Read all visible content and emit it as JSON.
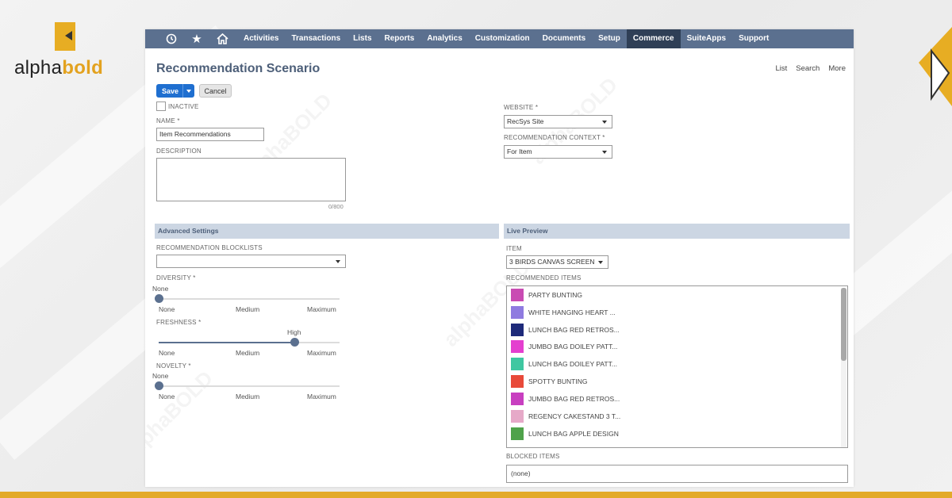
{
  "brand": {
    "logo_text_light": "alpha",
    "logo_text_bold": "bold",
    "watermark": "alphaBOLD",
    "accent_color": "#e3aa2a"
  },
  "nav": {
    "icons": [
      "recent-icon",
      "star-icon",
      "home-icon"
    ],
    "items": [
      "Activities",
      "Transactions",
      "Lists",
      "Reports",
      "Analytics",
      "Customization",
      "Documents",
      "Setup",
      "Commerce",
      "SuiteApps",
      "Support"
    ],
    "active": "Commerce"
  },
  "page": {
    "title": "Recommendation Scenario",
    "links": [
      "List",
      "Search",
      "More"
    ]
  },
  "actions": {
    "save_label": "Save",
    "cancel_label": "Cancel"
  },
  "form": {
    "inactive_label": "INACTIVE",
    "name_label": "NAME *",
    "name_value": "Item Recommendations",
    "description_label": "DESCRIPTION",
    "description_counter": "0/800",
    "website_label": "WEBSITE *",
    "website_value": "RecSys Site",
    "context_label": "RECOMMENDATION CONTEXT *",
    "context_value": "For Item"
  },
  "advanced": {
    "header": "Advanced Settings",
    "blocklists_label": "RECOMMENDATION BLOCKLISTS",
    "blocklists_value": "",
    "sliders": [
      {
        "label": "DIVERSITY *",
        "current": "None",
        "level": 0
      },
      {
        "label": "FRESHNESS *",
        "current": "High",
        "level": 0.75
      },
      {
        "label": "NOVELTY *",
        "current": "None",
        "level": 0
      }
    ],
    "scale": [
      "None",
      "Medium",
      "Maximum"
    ]
  },
  "preview": {
    "header": "Live Preview",
    "item_label": "ITEM",
    "item_value": "3 BIRDS CANVAS SCREEN",
    "recommended_label": "RECOMMENDED ITEMS",
    "recommended": [
      {
        "label": "PARTY BUNTING",
        "color": "#c94bb3"
      },
      {
        "label": "WHITE HANGING HEART ...",
        "color": "#8f7be0"
      },
      {
        "label": "LUNCH BAG RED RETROS...",
        "color": "#1e2a7a"
      },
      {
        "label": "JUMBO BAG DOILEY PATT...",
        "color": "#e43fcf"
      },
      {
        "label": "LUNCH BAG DOILEY PATT...",
        "color": "#3fc7a1"
      },
      {
        "label": "SPOTTY BUNTING",
        "color": "#e84a3a"
      },
      {
        "label": "JUMBO BAG RED RETROS...",
        "color": "#c83fc0"
      },
      {
        "label": "REGENCY CAKESTAND 3 T...",
        "color": "#e6a9c8"
      },
      {
        "label": "LUNCH BAG APPLE DESIGN",
        "color": "#4fa24a"
      }
    ],
    "blocked_label": "BLOCKED ITEMS",
    "blocked_value": "(none)"
  }
}
